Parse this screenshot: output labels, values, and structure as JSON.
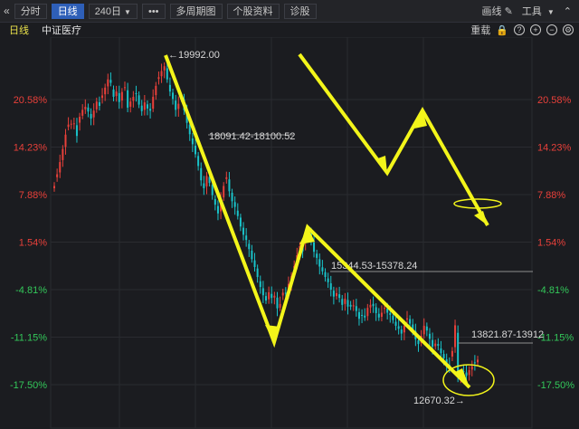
{
  "toolbar": {
    "collapse_icon": "«",
    "tabs": [
      "分时",
      "日线"
    ],
    "period": "240日",
    "more": "•••",
    "multi_period": "多周期图",
    "stock_info": "个股资料",
    "diagnose": "诊股",
    "draw_line": "画线",
    "tools": "工具",
    "up_icon": "⌃"
  },
  "subbar": {
    "period_label": "日线",
    "index_name": "中证医疗",
    "adjust": "重载"
  },
  "colors": {
    "up": "#e8403a",
    "down": "#19c3c9",
    "arrow": "#f3f51a",
    "grid": "#2a2b30",
    "bg": "#1b1c20"
  },
  "chart_data": {
    "type": "candlestick",
    "left_axis": [
      "20.58%",
      "14.23%",
      "7.88%",
      "1.54%",
      "-4.81%",
      "-11.15%",
      "-17.50%"
    ],
    "right_axis": [
      "20.58%",
      "14.23%",
      "7.88%",
      "1.54%",
      "-4.81%",
      "-11.15%",
      "-17.50%"
    ],
    "annotations": {
      "high": "←19992.00",
      "gap1": "18091.42-18100.52",
      "gap2": "15344.53-15378.24",
      "gap3": "13821.87-13912",
      "low": "12670.32→"
    },
    "ylim": [
      12400,
      20300
    ],
    "closes": [
      17150,
      17420,
      17700,
      18000,
      18330,
      18560,
      18580,
      18590,
      18300,
      18740,
      18900,
      18970,
      18860,
      18700,
      18880,
      19090,
      18990,
      19230,
      19410,
      19600,
      19520,
      19200,
      19320,
      19080,
      19310,
      19420,
      18950,
      19090,
      19200,
      19270,
      19020,
      18870,
      19070,
      18930,
      18880,
      19200,
      19450,
      19650,
      19790,
      19900,
      19600,
      19320,
      19150,
      18900,
      19040,
      19180,
      18890,
      18600,
      18340,
      18110,
      17880,
      17610,
      17280,
      17100,
      17380,
      17220,
      16940,
      16720,
      16520,
      16840,
      17150,
      17350,
      17030,
      16800,
      16670,
      16460,
      16220,
      16030,
      15910,
      15700,
      15470,
      15290,
      15060,
      14830,
      14640,
      14520,
      14710,
      14580,
      14630,
      14340,
      14440,
      14700,
      14690,
      14900,
      15080,
      15310,
      15560,
      15770,
      15650,
      15920,
      16090,
      15890,
      15640,
      15500,
      15300,
      15190,
      15060,
      14940,
      14770,
      14610,
      14690,
      14580,
      14420,
      14560,
      14380,
      14380,
      14410,
      14280,
      14100,
      14180,
      14130,
      14350,
      14420,
      14390,
      14230,
      14130,
      14240,
      14350,
      14240,
      14190,
      14070,
      13940,
      13870,
      13760,
      13940,
      14110,
      13990,
      13850,
      13630,
      13520,
      13710,
      13940,
      13830,
      13640,
      13460,
      13530,
      13480,
      13310,
      13190,
      13060,
      12940,
      13360,
      13950,
      12800,
      12820,
      12880,
      12790,
      12920,
      13010,
      13090,
      13160
    ]
  }
}
